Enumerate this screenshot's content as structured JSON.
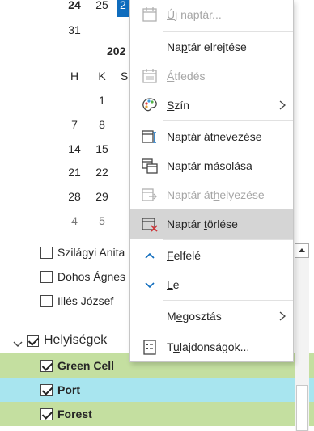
{
  "calendar": {
    "title": "202",
    "weekday_headers": [
      "H",
      "K",
      "S"
    ],
    "rows": [
      [
        "24",
        "25",
        "2"
      ],
      [
        "31",
        "",
        ""
      ],
      [
        "1",
        "",
        ""
      ],
      [
        "7",
        "8",
        ""
      ],
      [
        "14",
        "15",
        ""
      ],
      [
        "21",
        "22",
        ""
      ],
      [
        "28",
        "29",
        ""
      ],
      [
        "4",
        "5",
        ""
      ]
    ]
  },
  "people": [
    {
      "name": "Szilágyi Anita",
      "checked": false
    },
    {
      "name": "Dohos Ágnes",
      "checked": false
    },
    {
      "name": "Illés József",
      "checked": false
    }
  ],
  "group": {
    "label": "Helyiségek",
    "checked": true,
    "items": [
      {
        "name": "Green Cell",
        "checked": true,
        "color": "#c4dfa0"
      },
      {
        "name": "Port",
        "checked": true,
        "color": "#a8e5ef"
      },
      {
        "name": "Forest",
        "checked": true,
        "color": "#c4dfa0"
      }
    ]
  },
  "menu": {
    "items": [
      {
        "label_pre": "",
        "label_u": "Ú",
        "label_post": "j naptár...",
        "disabled": true,
        "icon": "new-calendar-icon"
      },
      {
        "label_pre": "Na",
        "label_u": "p",
        "label_post": "tár elrejtése",
        "disabled": false,
        "icon": ""
      },
      {
        "label_pre": "",
        "label_u": "Á",
        "label_post": "tfedés",
        "disabled": true,
        "icon": "overlay-icon"
      },
      {
        "label_pre": "",
        "label_u": "S",
        "label_post": "zín",
        "disabled": false,
        "icon": "color-palette-icon",
        "submenu": true
      },
      {
        "label_pre": "Naptár át",
        "label_u": "n",
        "label_post": "evezése",
        "disabled": false,
        "icon": "rename-icon"
      },
      {
        "label_pre": "",
        "label_u": "N",
        "label_post": "aptár másolása",
        "disabled": false,
        "icon": "copy-icon"
      },
      {
        "label_pre": "Naptár át",
        "label_u": "h",
        "label_post": "elyezése",
        "disabled": true,
        "icon": "move-icon"
      },
      {
        "label_pre": "Naptár ",
        "label_u": "t",
        "label_post": "örlése",
        "disabled": false,
        "icon": "delete-calendar-icon",
        "hover": true
      },
      {
        "label_pre": "",
        "label_u": "F",
        "label_post": "elfelé",
        "disabled": false,
        "icon": "chevron-up-icon"
      },
      {
        "label_pre": "",
        "label_u": "L",
        "label_post": "e",
        "disabled": false,
        "icon": "chevron-down-icon"
      },
      {
        "label_pre": "M",
        "label_u": "e",
        "label_post": "gosztás",
        "disabled": false,
        "icon": "",
        "submenu": true
      },
      {
        "label_pre": "T",
        "label_u": "u",
        "label_post": "lajdonságok...",
        "disabled": false,
        "icon": "properties-icon"
      }
    ]
  },
  "colors": {
    "accent": "#0f6cbd",
    "green": "#c4dfa0",
    "cyan": "#a8e5ef",
    "hover": "#d5d5d5"
  }
}
